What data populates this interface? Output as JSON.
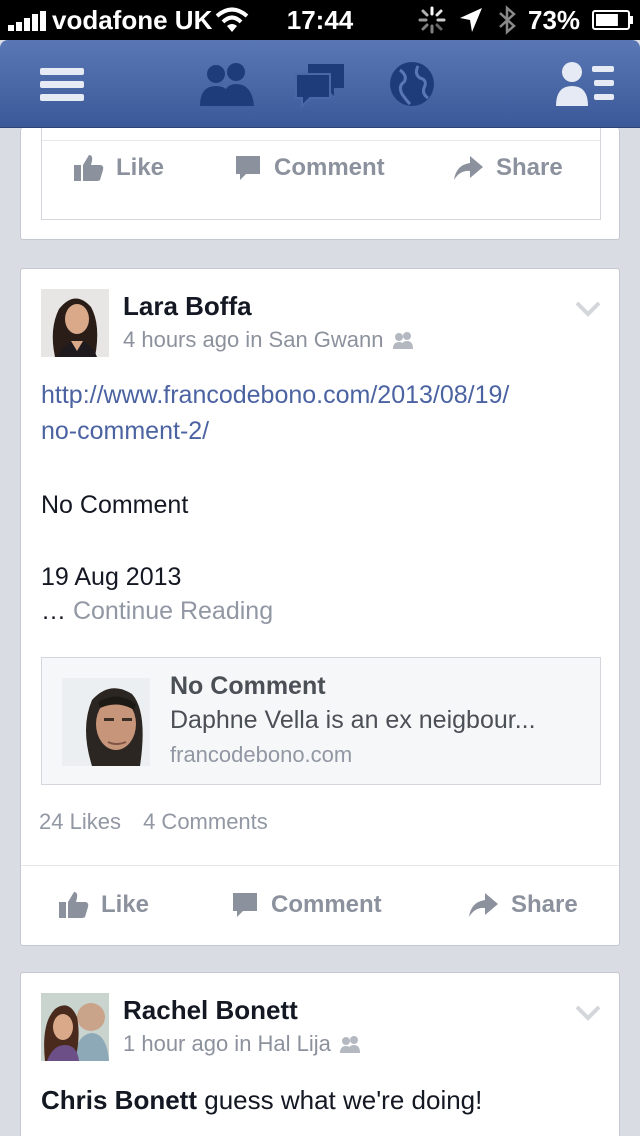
{
  "status_bar": {
    "carrier": "vodafone UK",
    "time": "17:44",
    "battery": "73%",
    "battery_level": 0.73
  },
  "nav": {
    "icons": [
      "menu-icon",
      "friend-requests-icon",
      "messages-icon",
      "notifications-globe-icon",
      "contacts-icon"
    ]
  },
  "actions": {
    "like": "Like",
    "comment": "Comment",
    "share": "Share"
  },
  "post1": {
    "author": "Lara Boffa",
    "meta": "4 hours ago in San Gwann",
    "link_line1": "http://www.francodebono.com/2013/08/19/",
    "link_line2": "no-comment-2/",
    "text1": "No Comment",
    "text2": "19 Aug 2013",
    "ellipsis": "…",
    "continue_reading": "Continue Reading",
    "attachment": {
      "title": "No Comment",
      "description": "Daphne Vella is an ex neigbour...",
      "domain": "francodebono.com"
    },
    "likes": "24 Likes",
    "comments": "4 Comments"
  },
  "post2": {
    "author": "Rachel Bonett",
    "meta": "1 hour ago in Hal Lija",
    "mention": "Chris Bonett",
    "text": "guess what we're doing!"
  },
  "colors": {
    "nav": "#3b5998",
    "link": "#4c63a2",
    "muted": "#8c929d",
    "background": "#d9dce3"
  }
}
